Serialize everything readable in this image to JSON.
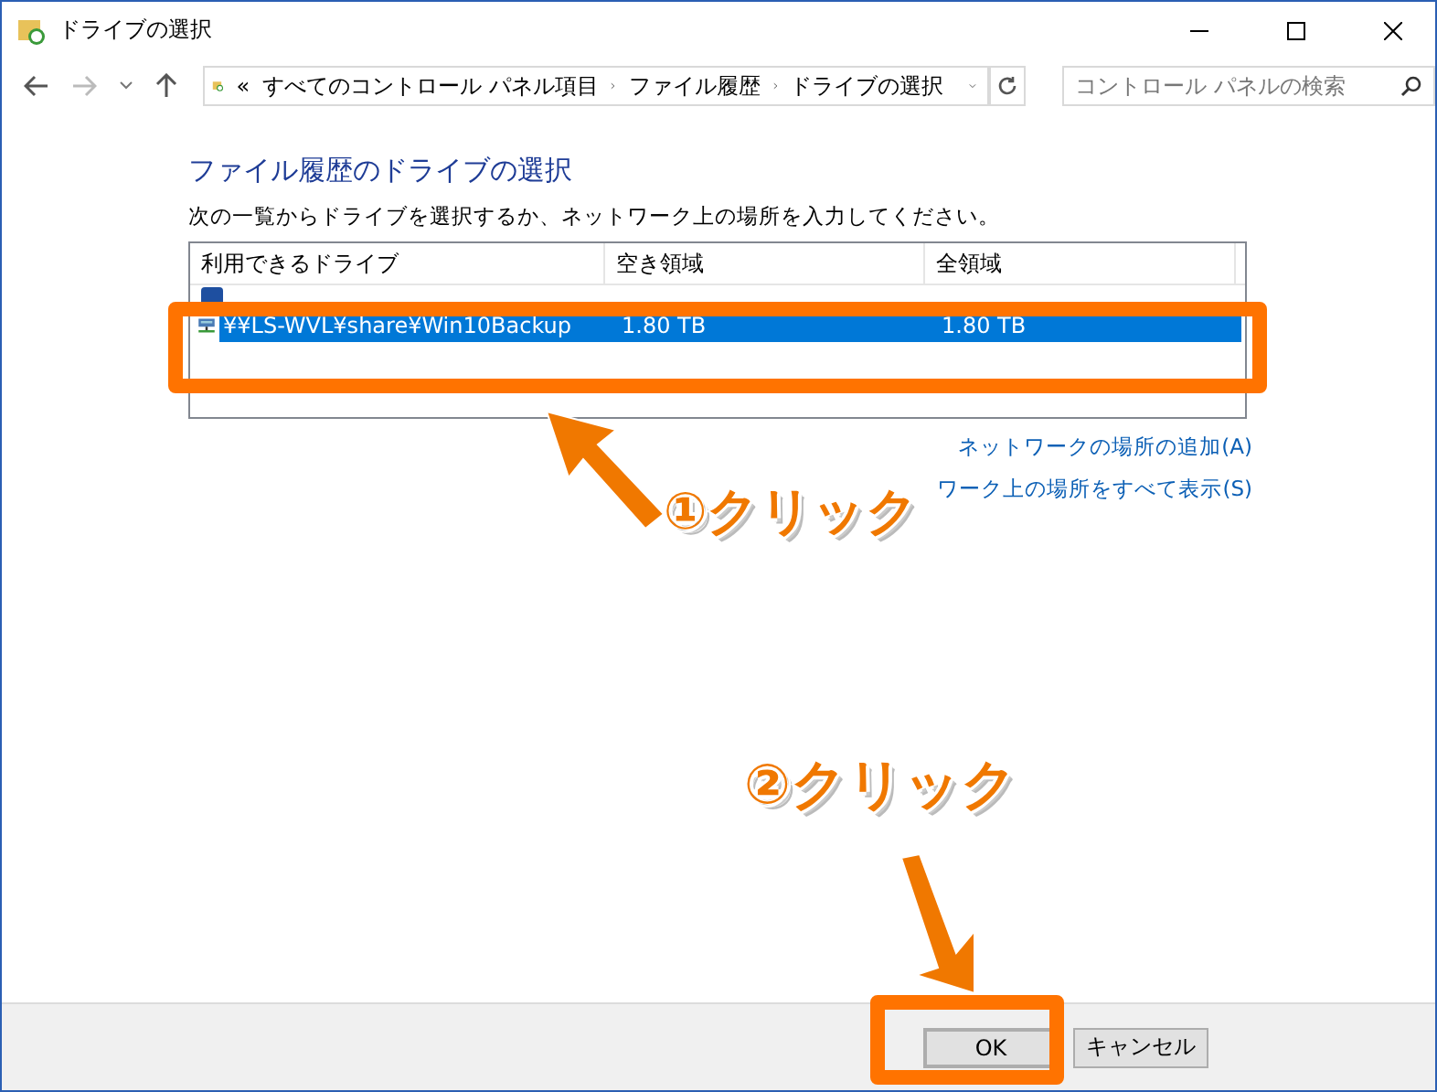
{
  "window": {
    "title": "ドライブの選択"
  },
  "address_bar": {
    "overflow": "«",
    "crumbs": [
      "すべてのコントロール パネル項目",
      "ファイル履歴",
      "ドライブの選択"
    ]
  },
  "search": {
    "placeholder": "コントロール パネルの検索"
  },
  "heading": "ファイル履歴のドライブの選択",
  "instruction": "次の一覧からドライブを選択するか、ネットワーク上の場所を入力してください。",
  "table": {
    "columns": [
      "利用できるドライブ",
      "空き領域",
      "全領域"
    ],
    "rows": [
      {
        "kind": "local",
        "cells": [],
        "selected": false
      },
      {
        "kind": "network",
        "cells": [
          "¥¥LS-WVL¥share¥Win10Backup",
          "1.80 TB",
          "1.80 TB"
        ],
        "selected": true
      }
    ]
  },
  "links": [
    "ネットワークの場所の追加(A)",
    "ワーク上の場所をすべて表示(S)"
  ],
  "buttons": [
    {
      "label": "OK",
      "default": true
    },
    {
      "label": "キャンセル",
      "default": false
    }
  ],
  "annotations": [
    {
      "text": "①クリック"
    },
    {
      "text": "②クリック"
    }
  ]
}
